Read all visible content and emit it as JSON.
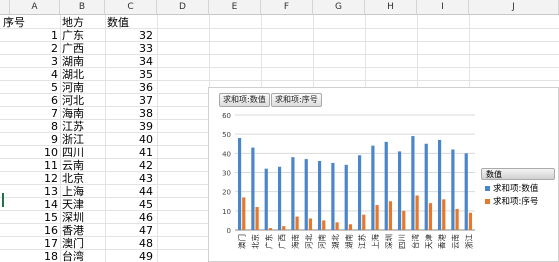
{
  "columns": [
    "A",
    "B",
    "C",
    "D",
    "E",
    "F",
    "G",
    "H",
    "I",
    "J"
  ],
  "table": {
    "headers": [
      "序号",
      "地方",
      "数值"
    ],
    "rows": [
      {
        "id": "1",
        "place": "广东",
        "value": "32"
      },
      {
        "id": "2",
        "place": "广西",
        "value": "33"
      },
      {
        "id": "3",
        "place": "湖南",
        "value": "34"
      },
      {
        "id": "4",
        "place": "湖北",
        "value": "35"
      },
      {
        "id": "5",
        "place": "河南",
        "value": "36"
      },
      {
        "id": "6",
        "place": "河北",
        "value": "37"
      },
      {
        "id": "7",
        "place": "海南",
        "value": "38"
      },
      {
        "id": "8",
        "place": "江苏",
        "value": "39"
      },
      {
        "id": "9",
        "place": "浙江",
        "value": "40"
      },
      {
        "id": "10",
        "place": "四川",
        "value": "41"
      },
      {
        "id": "11",
        "place": "云南",
        "value": "42"
      },
      {
        "id": "12",
        "place": "北京",
        "value": "43"
      },
      {
        "id": "13",
        "place": "上海",
        "value": "44"
      },
      {
        "id": "14",
        "place": "天津",
        "value": "45"
      },
      {
        "id": "15",
        "place": "深圳",
        "value": "46"
      },
      {
        "id": "16",
        "place": "香港",
        "value": "47"
      },
      {
        "id": "17",
        "place": "澳门",
        "value": "48"
      },
      {
        "id": "18",
        "place": "台湾",
        "value": "49"
      }
    ]
  },
  "chart": {
    "field_buttons": [
      "求和项:数值",
      "求和项:序号"
    ],
    "legend_title": "数值"
  },
  "chart_data": {
    "type": "bar",
    "categories": [
      "澳门",
      "北京",
      "广东",
      "广西",
      "海南",
      "河北",
      "河南",
      "湖北",
      "湖南",
      "江苏",
      "上海",
      "深圳",
      "四川",
      "台湾",
      "天津",
      "香港",
      "云南",
      "浙江"
    ],
    "series": [
      {
        "name": "求和项:数值",
        "color": "#4a86c8",
        "values": [
          48,
          43,
          32,
          33,
          38,
          37,
          36,
          35,
          34,
          39,
          44,
          46,
          41,
          49,
          45,
          47,
          42,
          40
        ]
      },
      {
        "name": "求和项:序号",
        "color": "#e6782c",
        "values": [
          17,
          12,
          1,
          2,
          7,
          6,
          5,
          4,
          3,
          8,
          13,
          15,
          10,
          18,
          14,
          16,
          11,
          9
        ]
      }
    ],
    "ylim": [
      0,
      60
    ],
    "yticks": [
      "0",
      "10",
      "20",
      "30",
      "40",
      "50",
      "60"
    ],
    "grid": true,
    "legend_position": "right"
  }
}
